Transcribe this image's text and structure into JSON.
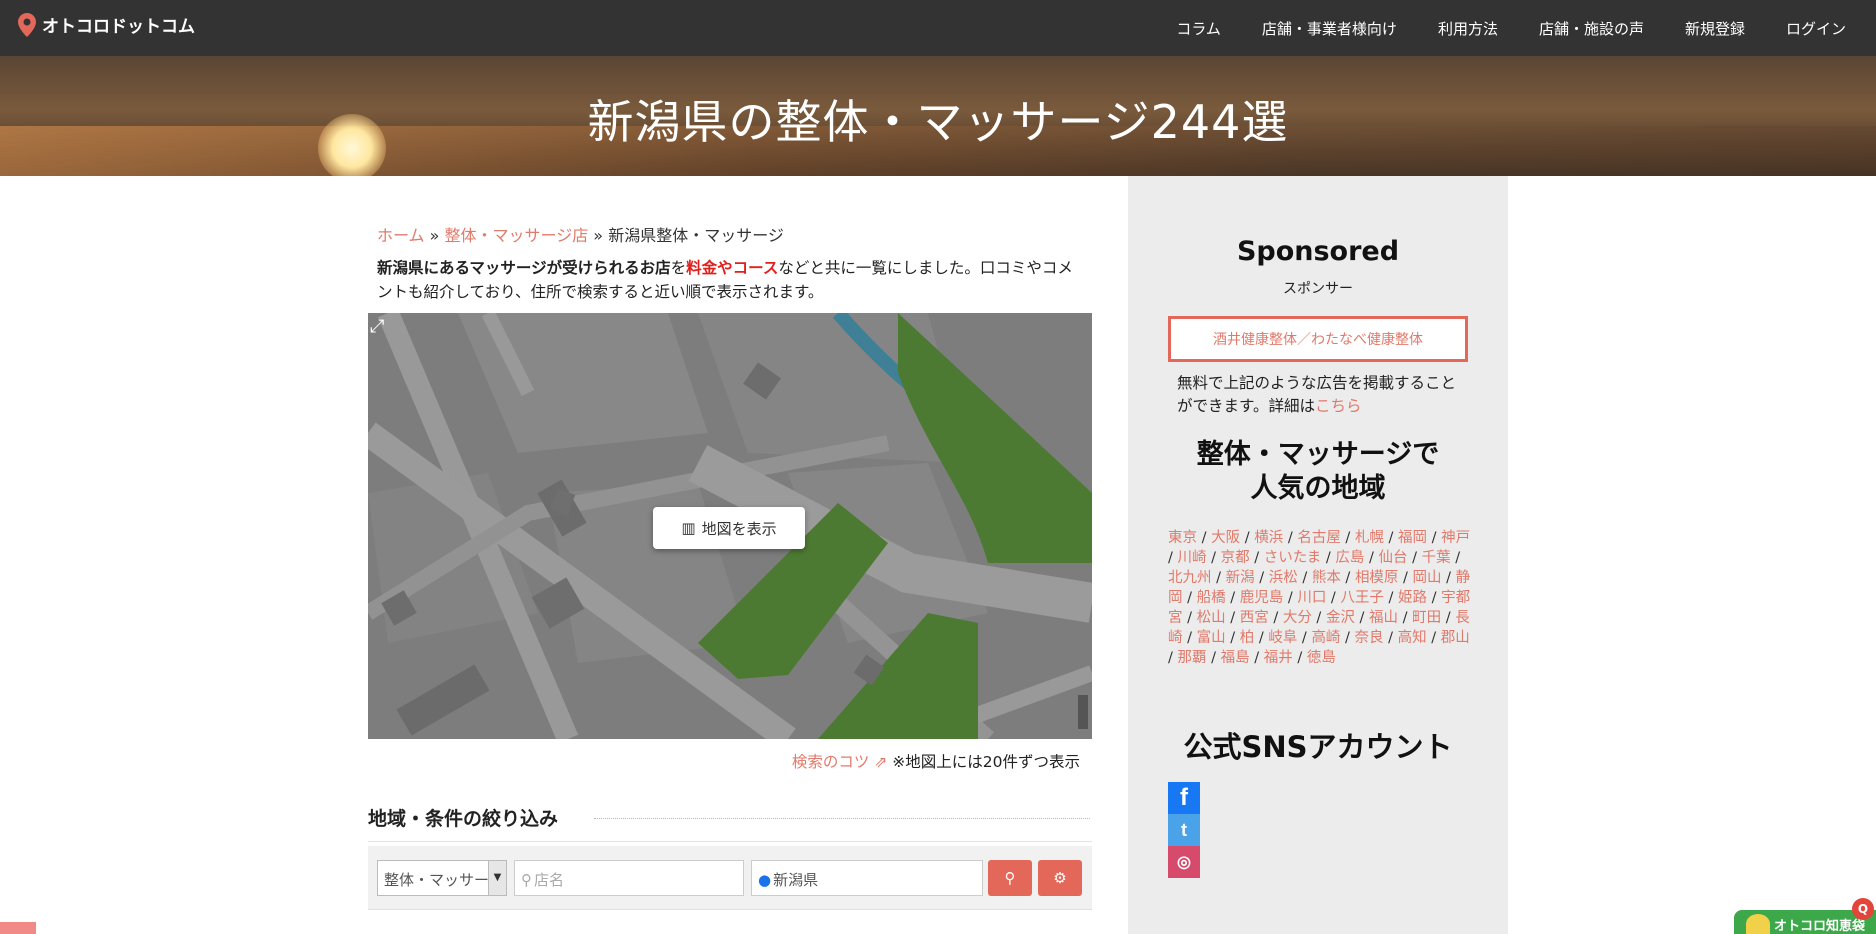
{
  "site": {
    "name": "オトコロドットコム"
  },
  "nav": [
    "コラム",
    "店舗・事業者様向け",
    "利用方法",
    "店舗・施設の声",
    "新規登録",
    "ログイン"
  ],
  "hero": {
    "title": "新潟県の整体・マッサージ244選"
  },
  "breadcrumb": {
    "home": "ホーム",
    "sep": "»",
    "category": "整体・マッサージ店",
    "current": "新潟県整体・マッサージ"
  },
  "intro": {
    "bold1": "新潟県にあるマッサージが受けられるお店",
    "t1": "を",
    "red": "料金やコース",
    "t2": "などと共に一覧にしました。口コミやコメントも紹介しており、住所で検索すると近い順で表示されます。"
  },
  "map": {
    "button_label": "地図を表示",
    "expand_icon": "expand-icon"
  },
  "tips": {
    "link": "検索のコツ",
    "note": "※地図上には20件ずつ表示"
  },
  "filter": {
    "title": "地域・条件の絞り込み",
    "category_value": "整体・マッサージ店",
    "name_placeholder": "店名",
    "location_value": "新潟県"
  },
  "sidebar": {
    "sponsored_title": "Sponsored",
    "sponsored_sub": "スポンサー",
    "ad_label": "酒井健康整体／わたなべ健康整体",
    "ad_note": "無料で上記のような広告を掲載することができます。詳細は",
    "ad_note_link": "こちら",
    "popular_title_1": "整体・マッサージで",
    "popular_title_2": "人気の地域",
    "regions": [
      "東京",
      "大阪",
      "横浜",
      "名古屋",
      "札幌",
      "福岡",
      "神戸",
      "川崎",
      "京都",
      "さいたま",
      "広島",
      "仙台",
      "千葉",
      "北九州",
      "新潟",
      "浜松",
      "熊本",
      "相模原",
      "岡山",
      "静岡",
      "船橋",
      "鹿児島",
      "川口",
      "八王子",
      "姫路",
      "宇都宮",
      "松山",
      "西宮",
      "大分",
      "金沢",
      "福山",
      "町田",
      "長崎",
      "富山",
      "柏",
      "岐阜",
      "高崎",
      "奈良",
      "高知",
      "郡山",
      "那覇",
      "福島",
      "福井",
      "徳島"
    ],
    "sns_title": "公式SNSアカウント"
  },
  "chat": {
    "label": "オトコロ知恵袋"
  },
  "colors": {
    "accent": "#e3685a",
    "link": "#e07a6b",
    "header": "#333333"
  }
}
